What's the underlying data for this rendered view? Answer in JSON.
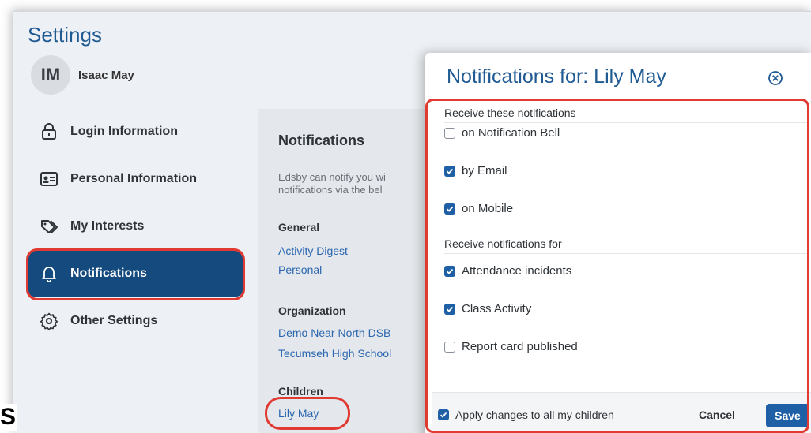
{
  "settings": {
    "title": "Settings",
    "user": {
      "initials": "IM",
      "name": "Isaac May"
    }
  },
  "sidebar": {
    "items": [
      {
        "label": "Login Information",
        "icon": "lock-icon",
        "active": false
      },
      {
        "label": "Personal Information",
        "icon": "id-card-icon",
        "active": false
      },
      {
        "label": "My Interests",
        "icon": "tag-icon",
        "active": false
      },
      {
        "label": "Notifications",
        "icon": "bell-icon",
        "active": true
      },
      {
        "label": "Other Settings",
        "icon": "gear-icon",
        "active": false
      }
    ]
  },
  "notifications_panel": {
    "title": "Notifications",
    "description_line1": "Edsby can notify you wi",
    "description_line2": "notifications via the bel",
    "general": {
      "title": "General",
      "links": [
        "Activity Digest",
        "Personal"
      ]
    },
    "organization": {
      "title": "Organization",
      "links": [
        "Demo Near North DSB",
        "Tecumseh High School"
      ]
    },
    "children": {
      "title": "Children",
      "links": [
        "Lily May"
      ]
    }
  },
  "modal": {
    "title": "Notifications for: Lily May",
    "receive_these_title": "Receive these notifications",
    "channels": [
      {
        "label": "on Notification Bell",
        "checked": false
      },
      {
        "label": "by Email",
        "checked": true
      },
      {
        "label": "on Mobile",
        "checked": true
      }
    ],
    "receive_for_title": "Receive notifications for",
    "types": [
      {
        "label": "Attendance incidents",
        "checked": true
      },
      {
        "label": "Class Activity",
        "checked": true
      },
      {
        "label": "Report card published",
        "checked": false
      }
    ],
    "apply_all": {
      "label": "Apply changes to all my children",
      "checked": true
    },
    "cancel_label": "Cancel",
    "save_label": "Save"
  },
  "stray_text": "S",
  "colors": {
    "accent": "#1f5a93",
    "nav_active": "#154a7e",
    "link": "#2a66b0",
    "annotation": "#e13a32"
  }
}
